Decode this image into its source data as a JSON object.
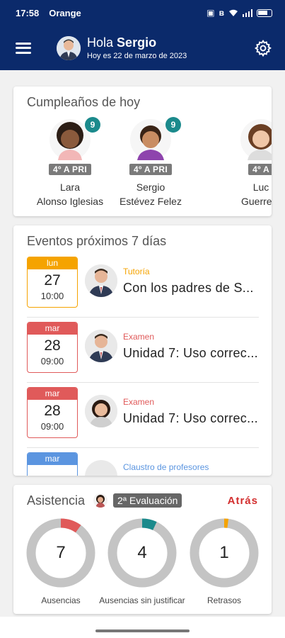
{
  "status": {
    "time": "17:58",
    "carrier": "Orange",
    "icons": [
      "nfc-icon",
      "bluetooth-icon",
      "wifi-icon",
      "signal-icon",
      "battery-icon"
    ]
  },
  "header": {
    "hello": "Hola",
    "name": "Sergio",
    "date": "Hoy es 22 de marzo de 2023"
  },
  "birthdays": {
    "title": "Cumpleaños de hoy",
    "people": [
      {
        "first": "Lara",
        "last": "Alonso Iglesias",
        "course": "4º A PRI",
        "age": "9"
      },
      {
        "first": "Sergio",
        "last": "Estévez Felez",
        "course": "4º A PRI",
        "age": "9"
      },
      {
        "first": "Luc",
        "last": "Guerrero",
        "course": "4º A",
        "age": ""
      }
    ]
  },
  "events": {
    "title": "Eventos próximos 7 días",
    "items": [
      {
        "dow": "lun",
        "day": "27",
        "hour": "10:00",
        "type": "Tutoría",
        "title": "Con los padres de S...",
        "color": "#f5a300"
      },
      {
        "dow": "mar",
        "day": "28",
        "hour": "09:00",
        "type": "Examen",
        "title": "Unidad 7: Uso correc...",
        "color": "#e05a5a"
      },
      {
        "dow": "mar",
        "day": "28",
        "hour": "09:00",
        "type": "Examen",
        "title": "Unidad 7: Uso correc...",
        "color": "#e05a5a"
      },
      {
        "dow": "mar",
        "day": "",
        "hour": "",
        "type": "Claustro de profesores",
        "title": "",
        "color": "#5b95e0"
      }
    ]
  },
  "attendance": {
    "title": "Asistencia",
    "evaluation": "2ª Evaluación",
    "back": "Atrás",
    "stats": [
      {
        "value": "7",
        "label": "Ausencias",
        "fraction": 0.1,
        "color": "#e05a5a"
      },
      {
        "value": "4",
        "label": "Ausencias sin justificar",
        "fraction": 0.07,
        "color": "#1b8a8c"
      },
      {
        "value": "1",
        "label": "Retrasos",
        "fraction": 0.02,
        "color": "#f5a300"
      }
    ]
  }
}
